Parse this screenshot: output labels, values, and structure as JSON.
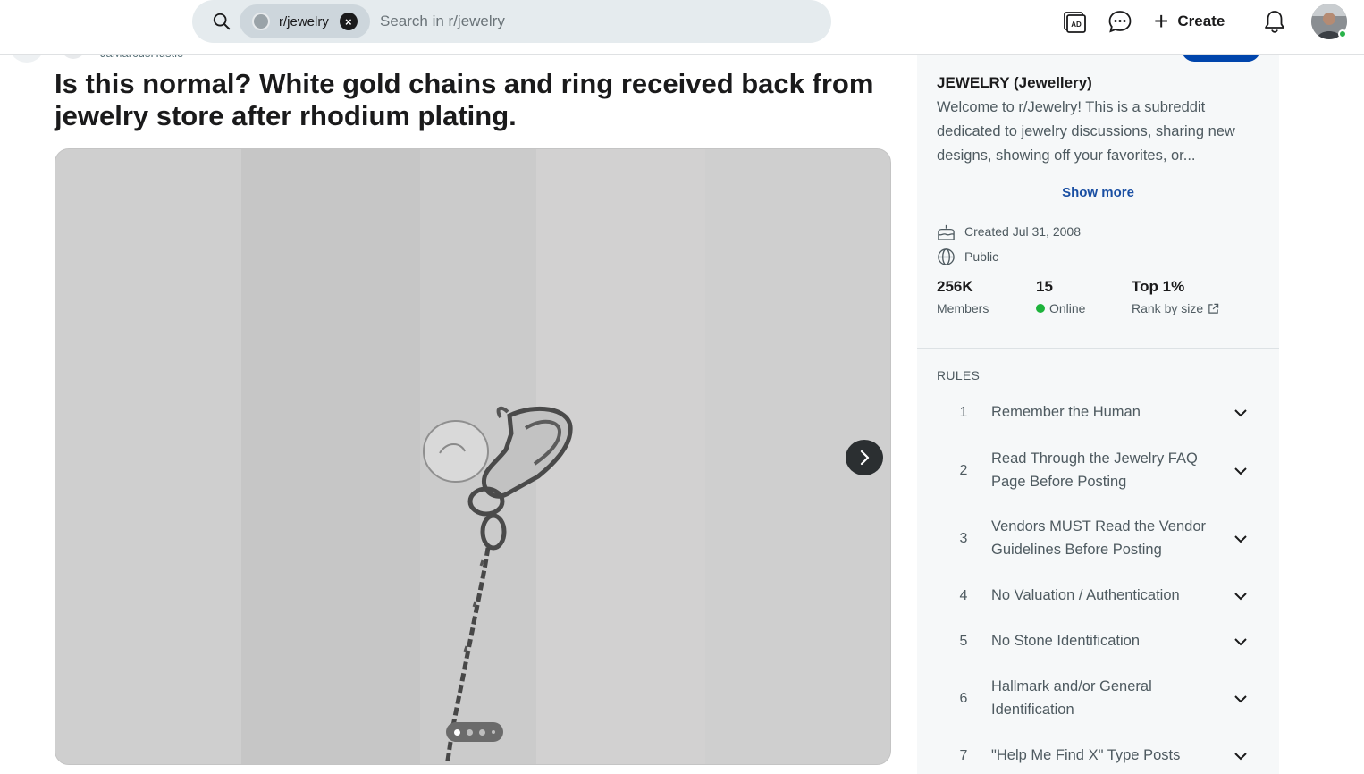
{
  "header": {
    "search_chip": "r/jewelry",
    "search_placeholder": "Search in r/jewelry",
    "create_label": "Create",
    "icons": [
      "search-icon",
      "advertise-icon",
      "chat-icon",
      "plus-icon",
      "bell-icon"
    ]
  },
  "post": {
    "author": "JaMarcusHustle",
    "title": "Is this normal? White gold chains and ring received back from jewelry store after rhodium plating.",
    "gallery_position": 1,
    "gallery_count": 4
  },
  "sidebar": {
    "community_name": "JEWELRY (Jewellery)",
    "description": "Welcome to r/Jewelry! This is a subreddit dedicated to jewelry discussions, sharing new designs, showing off your favorites, or...",
    "show_more": "Show more",
    "created": "Created Jul 31, 2008",
    "visibility": "Public",
    "stats": {
      "members_value": "256K",
      "members_label": "Members",
      "online_value": "15",
      "online_label": "Online",
      "rank_value": "Top 1%",
      "rank_label": "Rank by size"
    },
    "rules_heading": "RULES",
    "rules": [
      {
        "num": "1",
        "text": "Remember the Human"
      },
      {
        "num": "2",
        "text": "Read Through the Jewelry FAQ Page Before Posting"
      },
      {
        "num": "3",
        "text": "Vendors MUST Read the Vendor Guidelines Before Posting"
      },
      {
        "num": "4",
        "text": "No Valuation / Authentication"
      },
      {
        "num": "5",
        "text": "No Stone Identification"
      },
      {
        "num": "6",
        "text": "Hallmark and/or General Identification"
      },
      {
        "num": "7",
        "text": "\"Help Me Find X\" Type Posts"
      }
    ]
  },
  "colors": {
    "accent": "#0045ac",
    "link": "#1a4fa3",
    "online": "#1db33b",
    "search_bg": "#e5ebee"
  }
}
